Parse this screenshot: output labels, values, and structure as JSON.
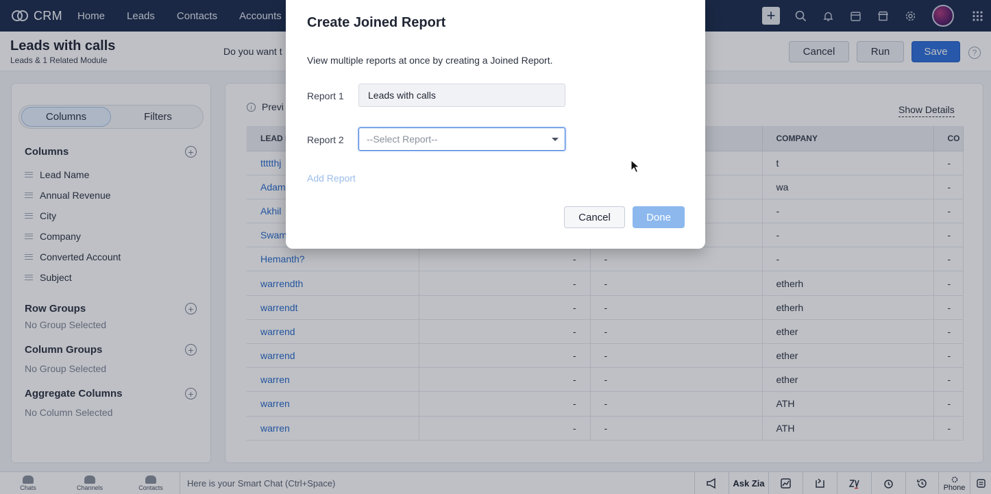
{
  "nav": {
    "brand": "CRM",
    "items": [
      "Home",
      "Leads",
      "Contacts",
      "Accounts"
    ],
    "right_icons": [
      "plus-icon",
      "search-icon",
      "bell-icon",
      "calendar-icon",
      "store-icon",
      "gear-icon",
      "avatar",
      "apps-grid-icon"
    ]
  },
  "header": {
    "title": "Leads with calls",
    "subtitle": "Leads & 1 Related Module",
    "prompt": "Do you want t",
    "cancel_label": "Cancel",
    "run_label": "Run",
    "save_label": "Save",
    "help": "?"
  },
  "left": {
    "toggle_columns": "Columns",
    "toggle_filters": "Filters",
    "columns_title": "Columns",
    "columns": [
      "Lead Name",
      "Annual Revenue",
      "City",
      "Company",
      "Converted Account",
      "Subject"
    ],
    "row_groups_title": "Row Groups",
    "row_groups_empty": "No Group Selected",
    "column_groups_title": "Column Groups",
    "column_groups_empty": "No Group Selected",
    "aggregate_title": "Aggregate Columns",
    "aggregate_empty": "No Column Selected"
  },
  "main": {
    "preview_label": "Previ",
    "show_details": "Show Details",
    "headers": [
      "LEAD I",
      "",
      "",
      "COMPANY",
      "CO"
    ],
    "rows": [
      [
        "ttttthj",
        "",
        "",
        "t",
        "-"
      ],
      [
        "Adam",
        "",
        "",
        "wa",
        "-"
      ],
      [
        "Akhil",
        "",
        "",
        "-",
        "-"
      ],
      [
        "Swam",
        "",
        "",
        "-",
        "-"
      ],
      [
        "Hemanth?",
        "-",
        "-",
        "-",
        "-"
      ],
      [
        "warrendth",
        "-",
        "-",
        "etherh",
        "-"
      ],
      [
        "warrendt",
        "-",
        "-",
        "etherh",
        "-"
      ],
      [
        "warrend",
        "-",
        "-",
        "ether",
        "-"
      ],
      [
        "warrend",
        "-",
        "-",
        "ether",
        "-"
      ],
      [
        "warren",
        "-",
        "-",
        "ether",
        "-"
      ],
      [
        "warren",
        "-",
        "-",
        "ATH",
        "-"
      ],
      [
        "warren",
        "-",
        "-",
        "ATH",
        "-"
      ]
    ]
  },
  "bottom": {
    "chats": "Chats",
    "channels": "Channels",
    "contacts": "Contacts",
    "smartchat_placeholder": "Here is your Smart Chat (Ctrl+Space)",
    "ask_zia": "Ask Zia",
    "phone": "Phone"
  },
  "modal": {
    "title": "Create Joined Report",
    "description": "View multiple reports at once by creating a Joined Report.",
    "report1_label": "Report 1",
    "report1_value": "Leads with calls",
    "report2_label": "Report 2",
    "report2_placeholder": "--Select Report--",
    "add_report": "Add Report",
    "cancel": "Cancel",
    "done": "Done"
  },
  "colors": {
    "nav_bg": "#1d2d4e",
    "primary": "#2f6fd8",
    "link": "#2a6ac9",
    "done_disabled": "#8cb8ee"
  }
}
